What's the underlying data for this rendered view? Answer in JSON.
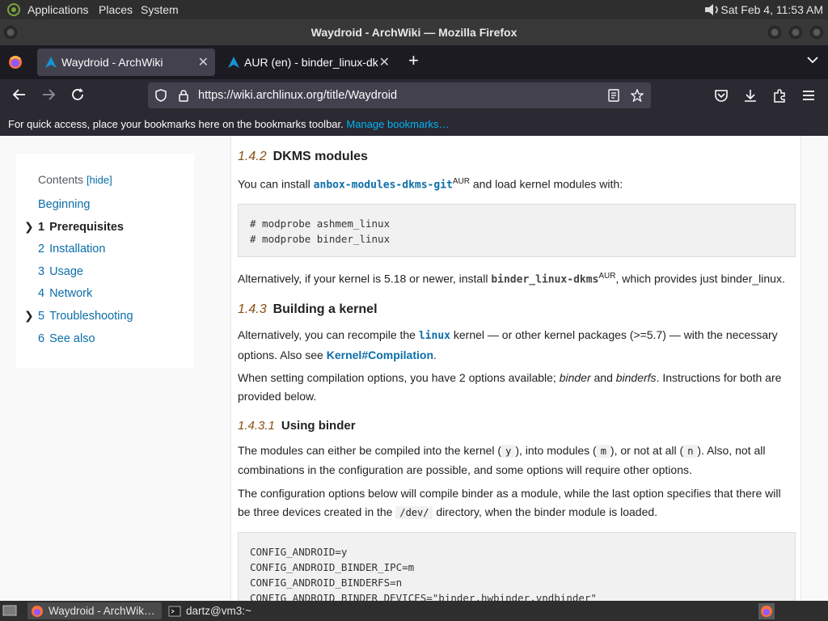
{
  "panel": {
    "applications": "Applications",
    "places": "Places",
    "system": "System",
    "clock": "Sat Feb  4, 11:53 AM"
  },
  "window": {
    "title": "Waydroid - ArchWiki — Mozilla Firefox"
  },
  "tabs": [
    {
      "title": "Waydroid - ArchWiki",
      "active": true
    },
    {
      "title": "AUR (en) - binder_linux-dkms",
      "active": false
    }
  ],
  "urlbar": {
    "url": "https://wiki.archlinux.org/title/Waydroid"
  },
  "bookmarks": {
    "message": "For quick access, place your bookmarks here on the bookmarks toolbar.",
    "manage_link": "Manage bookmarks…"
  },
  "toc": {
    "title": "Contents",
    "hide": "[hide]",
    "items": [
      {
        "num": "",
        "label": "Beginning"
      },
      {
        "num": "1",
        "label": "Prerequisites"
      },
      {
        "num": "2",
        "label": "Installation"
      },
      {
        "num": "3",
        "label": "Usage"
      },
      {
        "num": "4",
        "label": "Network"
      },
      {
        "num": "5",
        "label": "Troubleshooting"
      },
      {
        "num": "6",
        "label": "See also"
      }
    ]
  },
  "article": {
    "s142": {
      "num": "1.4.2",
      "title": "DKMS modules"
    },
    "p1": {
      "a": "You can install ",
      "pkg": "anbox-modules-dkms-git",
      "sup": "AUR",
      "b": " and load kernel modules with:"
    },
    "code1": "# modprobe ashmem_linux\n# modprobe binder_linux",
    "p2": {
      "a": "Alternatively, if your kernel is 5.18 or newer, install ",
      "pkg": "binder_linux-dkms",
      "sup": "AUR",
      "b": ", which provides just binder_linux."
    },
    "s143": {
      "num": "1.4.3",
      "title": "Building a kernel"
    },
    "p3": {
      "a": "Alternatively, you can recompile the ",
      "pkg": "linux",
      "b": " kernel — or other kernel packages (>=5.7) — with the necessary options. Also see ",
      "link": "Kernel#Compilation",
      "c": "."
    },
    "p4": {
      "a": "When setting compilation options, you have 2 options available; ",
      "i1": "binder",
      "b": " and ",
      "i2": "binderfs",
      "c": ". Instructions for both are provided below."
    },
    "s1431": {
      "num": "1.4.3.1",
      "title": "Using binder"
    },
    "p5": {
      "a": "The modules can either be compiled into the kernel (",
      "y": "y",
      "b": "), into modules (",
      "m": "m",
      "c": "), or not at all (",
      "n": "n",
      "d": "). Also, not all combinations in the configuration are possible, and some options will require other options."
    },
    "p6": {
      "a": "The configuration options below will compile binder as a module, while the last option specifies that there will be three devices created in the ",
      "dev": "/dev/",
      "b": " directory, when the binder module is loaded."
    },
    "code2": "CONFIG_ANDROID=y\nCONFIG_ANDROID_BINDER_IPC=m\nCONFIG_ANDROID_BINDERFS=n\nCONFIG_ANDROID_BINDER_DEVICES=\"binder,hwbinder,vndbinder\""
  },
  "taskbar": {
    "items": [
      {
        "label": "Waydroid - ArchWik…",
        "active": true
      },
      {
        "label": "dartz@vm3:~",
        "active": false
      }
    ]
  },
  "colors": {
    "link": "#0b6ea8",
    "section_number": "#8a4e12",
    "url_accent": "#00b3f4"
  }
}
